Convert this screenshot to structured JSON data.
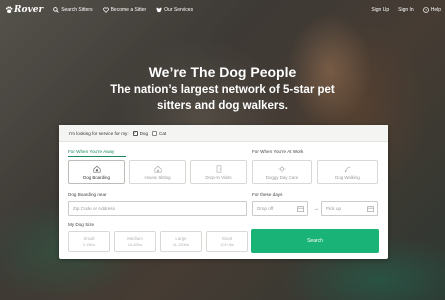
{
  "nav": {
    "logo": "Rover",
    "search_sitters": "Search Sitters",
    "become_sitter": "Become a Sitter",
    "our_services": "Our Services",
    "sign_up": "Sign Up",
    "sign_in": "Sign In",
    "help": "Help"
  },
  "hero": {
    "title": "We’re The Dog People",
    "subtitle": "The nation’s largest network of 5-star pet sitters and dog walkers."
  },
  "search": {
    "looking_for": "I'm looking for service for my:",
    "dog": "Dog",
    "cat": "Cat",
    "dog_checked": true,
    "cat_checked": false,
    "away_label": "For When You're Away",
    "work_label": "For When You're At Work",
    "services_away": [
      "Dog Boarding",
      "House Sitting",
      "Drop-In Visits"
    ],
    "services_work": [
      "Doggy Day Care",
      "Dog Walking"
    ],
    "active_service": "Dog Boarding",
    "location_label": "Dog Boarding near",
    "location_placeholder": "Zip Code or Address",
    "days_label": "For these days",
    "dropoff_placeholder": "Drop off",
    "pickup_placeholder": "Pick up",
    "size_label": "My Dog Size",
    "sizes": [
      {
        "name": "Small",
        "weight": "0-15lbs"
      },
      {
        "name": "Medium",
        "weight": "16-40lbs"
      },
      {
        "name": "Large",
        "weight": "41-100lbs"
      },
      {
        "name": "Giant",
        "weight": "101+lbs"
      }
    ],
    "search_button": "Search"
  },
  "colors": {
    "brand_green": "#19b277",
    "active_tab": "#1b8a5a"
  }
}
